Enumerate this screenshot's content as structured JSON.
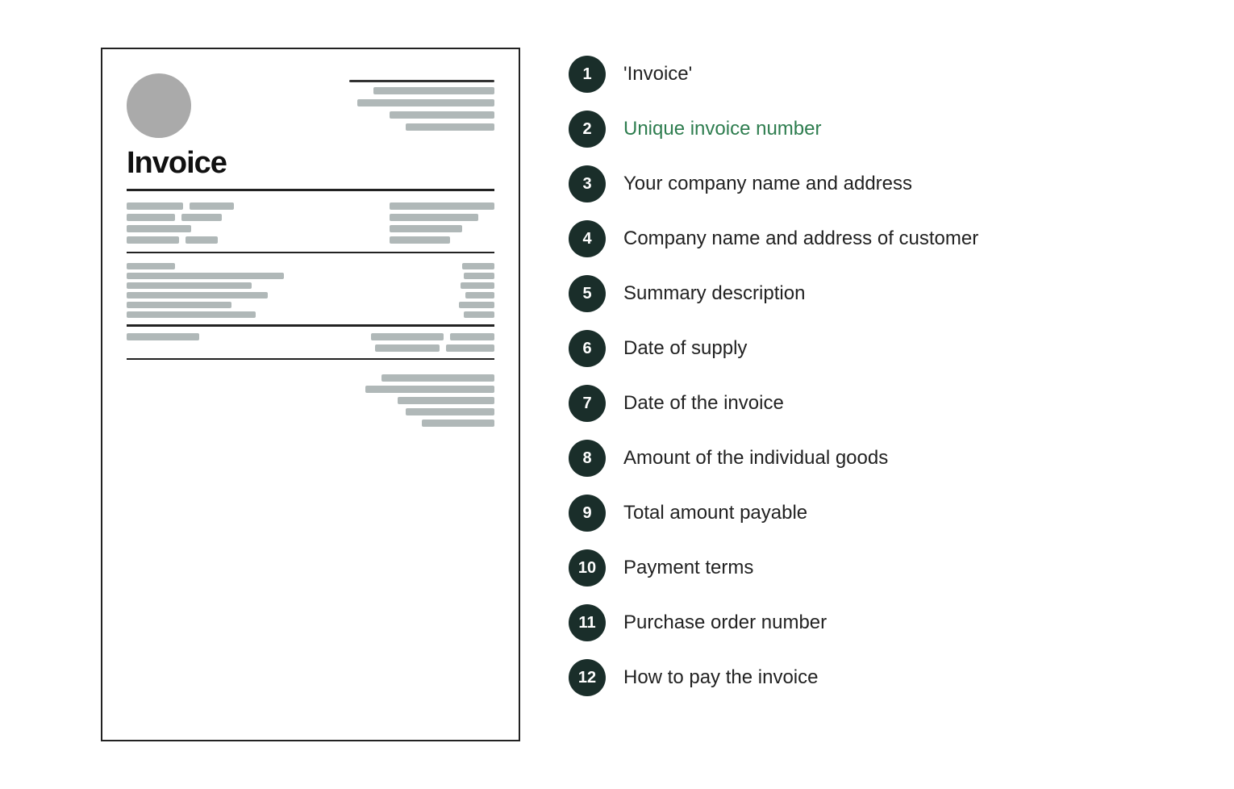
{
  "invoice_doc": {
    "title": "Invoice",
    "header_lines": [
      {
        "width": 180,
        "height": 3
      },
      {
        "width": 140,
        "height": 8
      },
      {
        "width": 160,
        "height": 8
      },
      {
        "width": 120,
        "height": 8
      },
      {
        "width": 100,
        "height": 8
      }
    ]
  },
  "numbered_items": [
    {
      "number": "1",
      "label": "'Invoice'",
      "green": false
    },
    {
      "number": "2",
      "label": "Unique invoice number",
      "green": true
    },
    {
      "number": "3",
      "label": "Your company name and address",
      "green": false
    },
    {
      "number": "4",
      "label": "Company name and address of customer",
      "green": false
    },
    {
      "number": "5",
      "label": "Summary description",
      "green": false
    },
    {
      "number": "6",
      "label": "Date of supply",
      "green": false
    },
    {
      "number": "7",
      "label": "Date of the invoice",
      "green": false
    },
    {
      "number": "8",
      "label": "Amount of the individual goods",
      "green": false
    },
    {
      "number": "9",
      "label": "Total amount payable",
      "green": false
    },
    {
      "number": "10",
      "label": "Payment terms",
      "green": false
    },
    {
      "number": "11",
      "label": "Purchase order number",
      "green": false
    },
    {
      "number": "12",
      "label": "How to pay the invoice",
      "green": false
    }
  ]
}
